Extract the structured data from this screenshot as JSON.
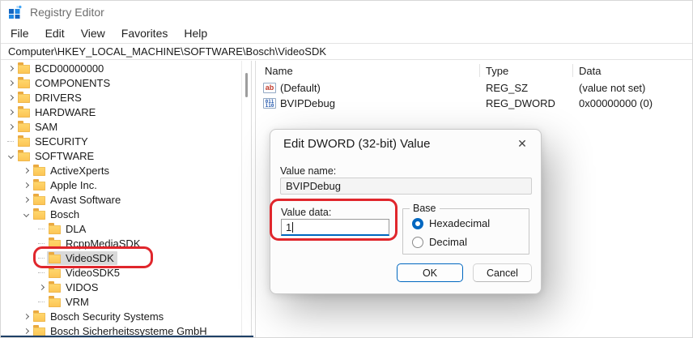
{
  "window": {
    "title": "Registry Editor"
  },
  "menu": {
    "items": [
      "File",
      "Edit",
      "View",
      "Favorites",
      "Help"
    ]
  },
  "address_bar": {
    "value": "Computer\\HKEY_LOCAL_MACHINE\\SOFTWARE\\Bosch\\VideoSDK"
  },
  "tree": {
    "items": [
      {
        "label": "BCD00000000",
        "level": 0,
        "expander": "collapsed",
        "selected": false
      },
      {
        "label": "COMPONENTS",
        "level": 0,
        "expander": "collapsed",
        "selected": false
      },
      {
        "label": "DRIVERS",
        "level": 0,
        "expander": "collapsed",
        "selected": false
      },
      {
        "label": "HARDWARE",
        "level": 0,
        "expander": "collapsed",
        "selected": false
      },
      {
        "label": "SAM",
        "level": 0,
        "expander": "collapsed",
        "selected": false
      },
      {
        "label": "SECURITY",
        "level": 0,
        "expander": "none",
        "selected": false
      },
      {
        "label": "SOFTWARE",
        "level": 0,
        "expander": "expanded",
        "selected": false
      },
      {
        "label": "ActiveXperts",
        "level": 1,
        "expander": "collapsed",
        "selected": false
      },
      {
        "label": "Apple Inc.",
        "level": 1,
        "expander": "collapsed",
        "selected": false
      },
      {
        "label": "Avast Software",
        "level": 1,
        "expander": "collapsed",
        "selected": false
      },
      {
        "label": "Bosch",
        "level": 1,
        "expander": "expanded",
        "selected": false
      },
      {
        "label": "DLA",
        "level": 2,
        "expander": "none",
        "selected": false
      },
      {
        "label": "RcppMediaSDK",
        "level": 2,
        "expander": "none",
        "selected": false
      },
      {
        "label": "VideoSDK",
        "level": 2,
        "expander": "none",
        "selected": true
      },
      {
        "label": "VideoSDK5",
        "level": 2,
        "expander": "none",
        "selected": false
      },
      {
        "label": "VIDOS",
        "level": 2,
        "expander": "collapsed",
        "selected": false
      },
      {
        "label": "VRM",
        "level": 2,
        "expander": "none",
        "selected": false
      },
      {
        "label": "Bosch Security Systems",
        "level": 1,
        "expander": "collapsed",
        "selected": false
      },
      {
        "label": "Bosch Sicherheitssysteme GmbH",
        "level": 1,
        "expander": "collapsed",
        "selected": false
      }
    ]
  },
  "list": {
    "columns": [
      "Name",
      "Type",
      "Data"
    ],
    "rows": [
      {
        "icon": "reg-sz-icon",
        "name": "(Default)",
        "type": "REG_SZ",
        "data": "(value not set)"
      },
      {
        "icon": "reg-dword-icon",
        "name": "BVIPDebug",
        "type": "REG_DWORD",
        "data": "0x00000000 (0)"
      }
    ]
  },
  "icons": {
    "string_glyph": "ab",
    "dword_top": "011",
    "dword_bottom": "110",
    "close_glyph": "✕"
  },
  "dialog": {
    "title": "Edit DWORD (32-bit) Value",
    "value_name_label": "Value name:",
    "value_name": "BVIPDebug",
    "value_data_label": "Value data:",
    "value_data": "1",
    "base_label": "Base",
    "radios": [
      {
        "label": "Hexadecimal",
        "selected": true
      },
      {
        "label": "Decimal",
        "selected": false
      }
    ],
    "ok_label": "OK",
    "cancel_label": "Cancel"
  },
  "colors": {
    "accent": "#0067c0",
    "annotation": "#e0262c",
    "selection": "#d9d9d9"
  }
}
